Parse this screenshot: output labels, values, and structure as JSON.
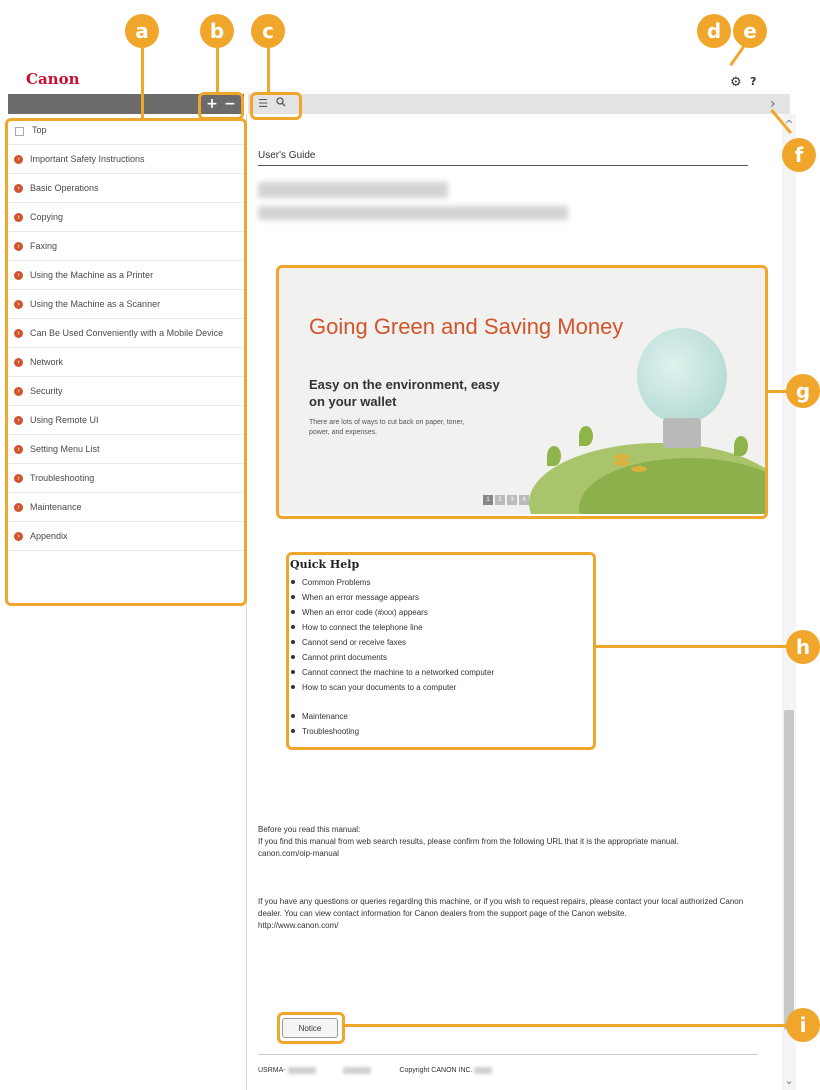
{
  "brand": {
    "logo_text": "Canon",
    "brand_red": "#c8102e",
    "accent_orange": "#f0a62a"
  },
  "toolbar": {
    "expand_icon": "plus-icon",
    "collapse_icon": "minus-icon",
    "contents_icon": "list-icon",
    "search_icon": "search-icon",
    "settings_icon": "gear-icon",
    "help_label": "?",
    "next_label": "›"
  },
  "sidebar": {
    "items": [
      {
        "label": "Top"
      },
      {
        "label": "Important Safety Instructions"
      },
      {
        "label": "Basic Operations"
      },
      {
        "label": "Copying"
      },
      {
        "label": "Faxing"
      },
      {
        "label": "Using the Machine as a Printer"
      },
      {
        "label": "Using the Machine as a Scanner"
      },
      {
        "label": "Can Be Used Conveniently with a Mobile Device"
      },
      {
        "label": "Network"
      },
      {
        "label": "Security"
      },
      {
        "label": "Using Remote UI"
      },
      {
        "label": "Setting Menu List"
      },
      {
        "label": "Troubleshooting"
      },
      {
        "label": "Maintenance"
      },
      {
        "label": "Appendix"
      }
    ]
  },
  "main": {
    "guide_title": "User's Guide",
    "banner": {
      "title": "Going Green and Saving Money",
      "subtitle": "Easy on the environment, easy on your wallet",
      "body": "There are lots of ways to cut back on paper, toner, power, and expenses.",
      "pages": [
        "1",
        "2",
        "3",
        "4"
      ],
      "active_page": 1
    },
    "quick_help": {
      "title": "Quick Help",
      "items": [
        "Common Problems",
        "When an error message appears",
        "When an error code (#xxx) appears",
        "How to connect the telephone line",
        "Cannot send or receive faxes",
        "Cannot print documents",
        "Cannot connect the machine to a networked computer",
        "How to scan your documents to a computer"
      ],
      "items2": [
        "Maintenance",
        "Troubleshooting"
      ]
    },
    "before_read": {
      "line1": "Before you read this manual:",
      "line2": "If you find this manual from web search results, please confirm from the following URL that it is the appropriate manual.",
      "url": "canon.com/oip-manual"
    },
    "contact": {
      "text": "If you have any questions or queries regarding this machine, or if you wish to request repairs, please contact your local authorized Canon dealer. You can view contact information for Canon dealers from the support page of the Canon website.",
      "url": "http://www.canon.com/"
    },
    "notice_label": "Notice",
    "footer": {
      "code_prefix": "USRMA-",
      "copyright": "Copyright CANON INC."
    }
  },
  "callouts": [
    "a",
    "b",
    "c",
    "d",
    "e",
    "f",
    "g",
    "h",
    "i"
  ]
}
